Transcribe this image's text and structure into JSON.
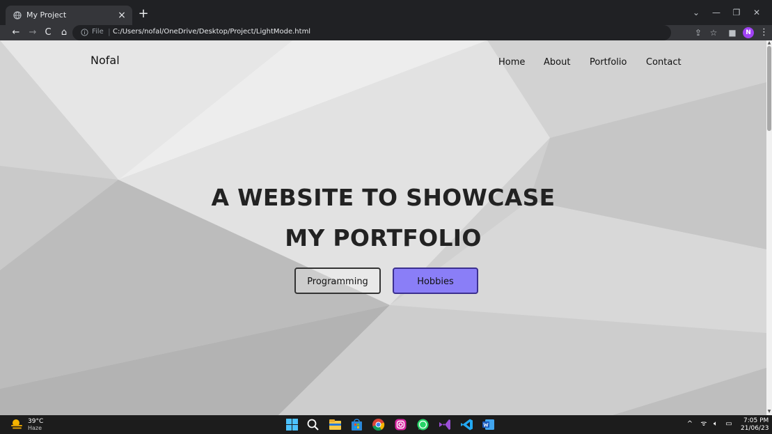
{
  "browser": {
    "tab_title": "My Project",
    "tab_close": "×",
    "new_tab": "+",
    "url_scheme": "File",
    "url_separator": "|",
    "url_path": "C:/Users/nofal/OneDrive/Desktop/Project/LightMode.html",
    "profile_initial": "N"
  },
  "page": {
    "brand": "Nofal",
    "nav": [
      {
        "label": "Home"
      },
      {
        "label": "About"
      },
      {
        "label": "Portfolio"
      },
      {
        "label": "Contact"
      }
    ],
    "hero_line1": "A WEBSITE TO SHOWCASE",
    "hero_line2": "MY PORTFOLIO",
    "buttons": {
      "programming": "Programming",
      "hobbies": "Hobbies"
    },
    "colors": {
      "hobbies_bg": "#8a7ef7",
      "hobbies_border": "#3b2f8f"
    }
  },
  "taskbar": {
    "temperature": "39°C",
    "condition": "Haze",
    "time": "7:05 PM",
    "date": "21/06/23"
  }
}
